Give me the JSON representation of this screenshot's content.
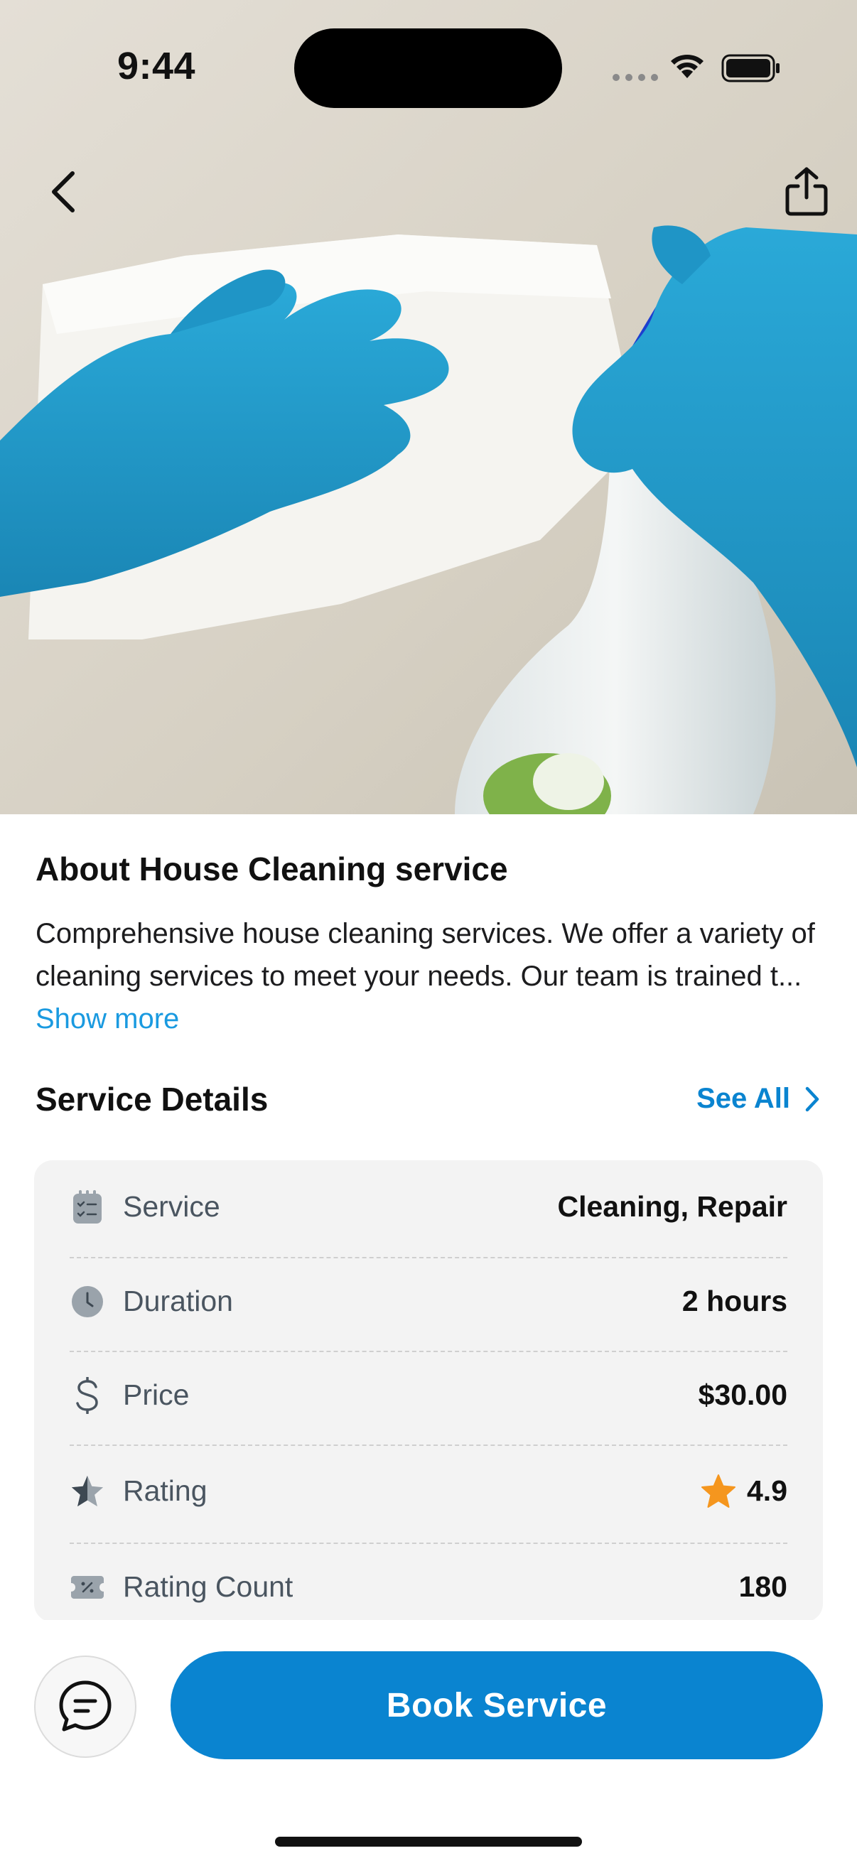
{
  "status_bar": {
    "time": "9:44"
  },
  "hero": {
    "image_icon": "cleaning-photo"
  },
  "nav": {
    "back_icon": "chevron-left-icon",
    "share_icon": "share-icon"
  },
  "about": {
    "title": "About House Cleaning service",
    "text": "Comprehensive house cleaning services. We offer a variety of cleaning services to meet your needs. Our team is trained t... ",
    "show_more": "Show more"
  },
  "details": {
    "title": "Service Details",
    "see_all": "See All",
    "rows": [
      {
        "label": "Service",
        "value": "Cleaning, Repair",
        "icon": "checklist-icon"
      },
      {
        "label": "Duration",
        "value": "2 hours",
        "icon": "clock-icon"
      },
      {
        "label": "Price",
        "value": "$30.00",
        "icon": "dollar-icon"
      },
      {
        "label": "Rating",
        "value": "4.9",
        "icon": "half-star-icon",
        "value_icon": "star-icon"
      },
      {
        "label": "Rating Count",
        "value": "180",
        "icon": "ticket-icon"
      }
    ]
  },
  "bottom": {
    "book_label": "Book Service",
    "chat_icon": "chat-icon"
  },
  "colors": {
    "accent": "#0a84d0",
    "link": "#1a9ae0",
    "star": "#f5961e"
  }
}
